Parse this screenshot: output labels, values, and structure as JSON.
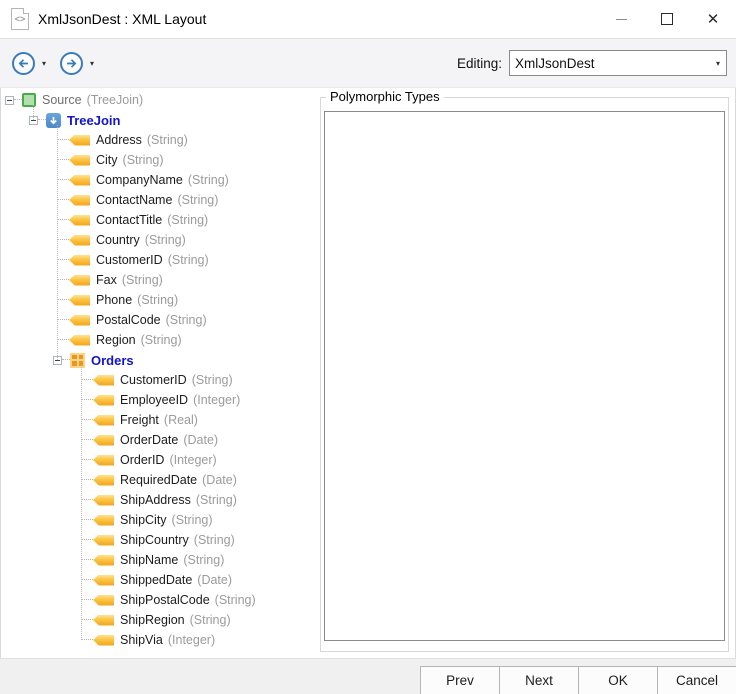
{
  "window": {
    "title": "XmlJsonDest : XML Layout",
    "app_icon_glyph": "<>"
  },
  "toolbar": {
    "editing_label": "Editing:",
    "editing_value": "XmlJsonDest"
  },
  "panel": {
    "title": "Polymorphic Types"
  },
  "footer": {
    "buttons": [
      {
        "name": "prev",
        "label": "Prev"
      },
      {
        "name": "next",
        "label": "Next"
      },
      {
        "name": "ok",
        "label": "OK"
      },
      {
        "name": "cancel",
        "label": "Cancel"
      }
    ]
  },
  "tree": {
    "nodes": [
      {
        "level": 0,
        "icon": "source",
        "kind": "root",
        "expandable": true,
        "name": "Source",
        "type": "(TreeJoin)"
      },
      {
        "level": 1,
        "icon": "treejoin",
        "kind": "section",
        "expandable": true,
        "name": "TreeJoin",
        "type": ""
      },
      {
        "level": 2,
        "icon": "field",
        "kind": "leaf",
        "expandable": false,
        "name": "Address",
        "type": "(String)"
      },
      {
        "level": 2,
        "icon": "field",
        "kind": "leaf",
        "expandable": false,
        "name": "City",
        "type": "(String)"
      },
      {
        "level": 2,
        "icon": "field",
        "kind": "leaf",
        "expandable": false,
        "name": "CompanyName",
        "type": "(String)"
      },
      {
        "level": 2,
        "icon": "field",
        "kind": "leaf",
        "expandable": false,
        "name": "ContactName",
        "type": "(String)"
      },
      {
        "level": 2,
        "icon": "field",
        "kind": "leaf",
        "expandable": false,
        "name": "ContactTitle",
        "type": "(String)"
      },
      {
        "level": 2,
        "icon": "field",
        "kind": "leaf",
        "expandable": false,
        "name": "Country",
        "type": "(String)"
      },
      {
        "level": 2,
        "icon": "field",
        "kind": "leaf",
        "expandable": false,
        "name": "CustomerID",
        "type": "(String)"
      },
      {
        "level": 2,
        "icon": "field",
        "kind": "leaf",
        "expandable": false,
        "name": "Fax",
        "type": "(String)"
      },
      {
        "level": 2,
        "icon": "field",
        "kind": "leaf",
        "expandable": false,
        "name": "Phone",
        "type": "(String)"
      },
      {
        "level": 2,
        "icon": "field",
        "kind": "leaf",
        "expandable": false,
        "name": "PostalCode",
        "type": "(String)"
      },
      {
        "level": 2,
        "icon": "field",
        "kind": "leaf",
        "expandable": false,
        "name": "Region",
        "type": "(String)"
      },
      {
        "level": 2,
        "icon": "orders",
        "kind": "section",
        "expandable": true,
        "name": "Orders",
        "type": ""
      },
      {
        "level": 3,
        "icon": "field",
        "kind": "leaf",
        "expandable": false,
        "name": "CustomerID",
        "type": "(String)"
      },
      {
        "level": 3,
        "icon": "field",
        "kind": "leaf",
        "expandable": false,
        "name": "EmployeeID",
        "type": "(Integer)"
      },
      {
        "level": 3,
        "icon": "field",
        "kind": "leaf",
        "expandable": false,
        "name": "Freight",
        "type": "(Real)"
      },
      {
        "level": 3,
        "icon": "field",
        "kind": "leaf",
        "expandable": false,
        "name": "OrderDate",
        "type": "(Date)"
      },
      {
        "level": 3,
        "icon": "field",
        "kind": "leaf",
        "expandable": false,
        "name": "OrderID",
        "type": "(Integer)"
      },
      {
        "level": 3,
        "icon": "field",
        "kind": "leaf",
        "expandable": false,
        "name": "RequiredDate",
        "type": "(Date)"
      },
      {
        "level": 3,
        "icon": "field",
        "kind": "leaf",
        "expandable": false,
        "name": "ShipAddress",
        "type": "(String)"
      },
      {
        "level": 3,
        "icon": "field",
        "kind": "leaf",
        "expandable": false,
        "name": "ShipCity",
        "type": "(String)"
      },
      {
        "level": 3,
        "icon": "field",
        "kind": "leaf",
        "expandable": false,
        "name": "ShipCountry",
        "type": "(String)"
      },
      {
        "level": 3,
        "icon": "field",
        "kind": "leaf",
        "expandable": false,
        "name": "ShipName",
        "type": "(String)"
      },
      {
        "level": 3,
        "icon": "field",
        "kind": "leaf",
        "expandable": false,
        "name": "ShippedDate",
        "type": "(Date)"
      },
      {
        "level": 3,
        "icon": "field",
        "kind": "leaf",
        "expandable": false,
        "name": "ShipPostalCode",
        "type": "(String)"
      },
      {
        "level": 3,
        "icon": "field",
        "kind": "leaf",
        "expandable": false,
        "name": "ShipRegion",
        "type": "(String)"
      },
      {
        "level": 3,
        "icon": "field",
        "kind": "leaf",
        "expandable": false,
        "name": "ShipVia",
        "type": "(Integer)"
      }
    ]
  },
  "colors": {
    "accent_blue": "#3a7abf",
    "node_blue": "#1313cb",
    "type_gray": "#9b9b9b",
    "leaf_icon_orange": "#f1a11d",
    "source_icon_green": "#4aab49",
    "orders_icon_orange": "#e9971d"
  }
}
